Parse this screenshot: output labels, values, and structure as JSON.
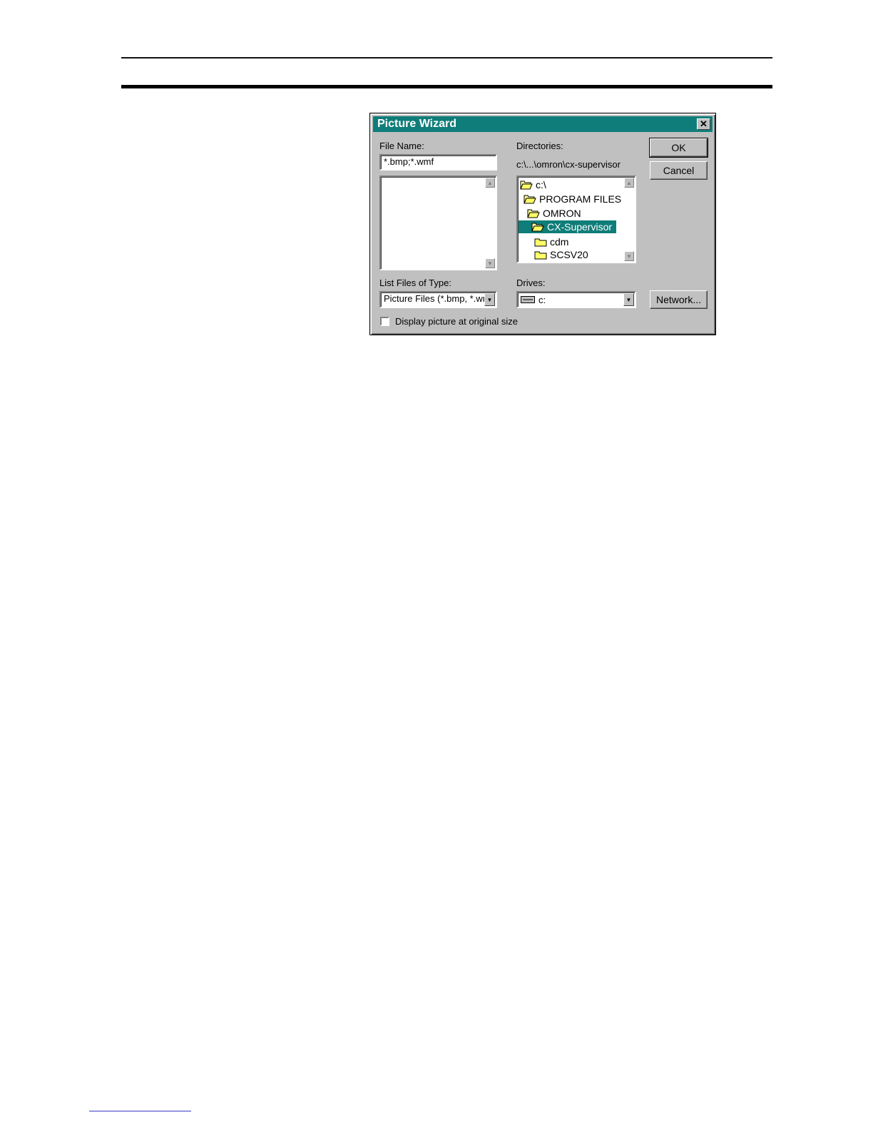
{
  "dialog": {
    "title": "Picture Wizard",
    "file_name_label": "File Name:",
    "file_name_value": "*.bmp;*.wmf",
    "directories_label": "Directories:",
    "current_path": "c:\\...\\omron\\cx-supervisor",
    "directories": [
      {
        "label": "c:\\",
        "state": "open"
      },
      {
        "label": "PROGRAM FILES",
        "state": "open"
      },
      {
        "label": "OMRON",
        "state": "open"
      },
      {
        "label": "CX-Supervisor",
        "state": "open",
        "selected": true
      },
      {
        "label": "cdm",
        "state": "closed"
      },
      {
        "label": "SCSV20",
        "state": "closed"
      }
    ],
    "list_files_label": "List Files of Type:",
    "file_type_value": "Picture Files (*.bmp, *.wr",
    "drives_label": "Drives:",
    "drive_value": "c:",
    "checkbox_label": "Display picture at original size",
    "checkbox_checked": false,
    "ok_label": "OK",
    "cancel_label": "Cancel",
    "network_label": "Network...",
    "close_glyph": "✕",
    "accent_color": "#0f7d79"
  }
}
